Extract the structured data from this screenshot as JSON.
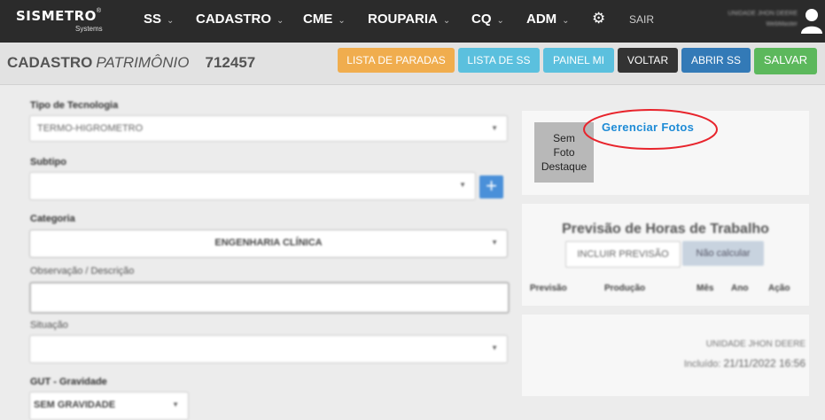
{
  "brand": {
    "name": "SISMETRO",
    "reg": "®",
    "sub": "Systems"
  },
  "nav": {
    "items": [
      {
        "label": "SS"
      },
      {
        "label": "CADASTRO"
      },
      {
        "label": "CME"
      },
      {
        "label": "ROUPARIA"
      },
      {
        "label": "CQ"
      },
      {
        "label": "ADM"
      }
    ],
    "chevron": "⌄",
    "settings_icon": "gear-icon",
    "logout": "SAIR",
    "user_line1": "UNIDADE JHON DEERE",
    "user_line2": "WebMaster"
  },
  "header": {
    "title_bold": "CADASTRO",
    "title_italic": "PATRIMÔNIO",
    "asset_number": "712457"
  },
  "actions": {
    "lista_paradas": "LISTA DE PARADAS",
    "lista_ss": "LISTA DE SS",
    "painel_mi": "PAINEL MI",
    "voltar": "VOLTAR",
    "abrir_ss": "ABRIR SS",
    "salvar": "SALVAR"
  },
  "form": {
    "tipo_tecnologia": {
      "label": "Tipo de Tecnologia",
      "value": "TERMO-HIGROMETRO"
    },
    "subtipo": {
      "label": "Subtipo",
      "value": ""
    },
    "categoria": {
      "label": "Categoria",
      "value": "ENGENHARIA CLÍNICA"
    },
    "observacao": {
      "label": "Observação / Descrição",
      "value": ""
    },
    "situacao": {
      "label": "Situação",
      "value": ""
    },
    "gut": {
      "label": "GUT - Gravidade",
      "value": "SEM GRAVIDADE"
    },
    "add_icon": "+"
  },
  "photos": {
    "placeholder_lines": [
      "Sem",
      "Foto",
      "Destaque"
    ],
    "manage_link": "Gerenciar Fotos"
  },
  "work_hours": {
    "title": "Previsão de Horas de Trabalho",
    "include_button": "INCLUIR PREVISÃO",
    "no_calc_button": "Não calcular",
    "columns": [
      "Previsão",
      "Produção",
      "Mês",
      "Ano",
      "Ação"
    ]
  },
  "record_meta": {
    "unit": "UNIDADE JHON DEERE",
    "included_label": "Incluído:",
    "included_date": "21/11/2022 16:56"
  },
  "colors": {
    "navbar": "#2b2b2b",
    "orange": "#f0ad4e",
    "teal": "#5bc0de",
    "dark": "#333333",
    "blue": "#337ab7",
    "green": "#5cb85c",
    "link": "#1e8bd6",
    "highlight_ellipse": "#e8242c"
  }
}
